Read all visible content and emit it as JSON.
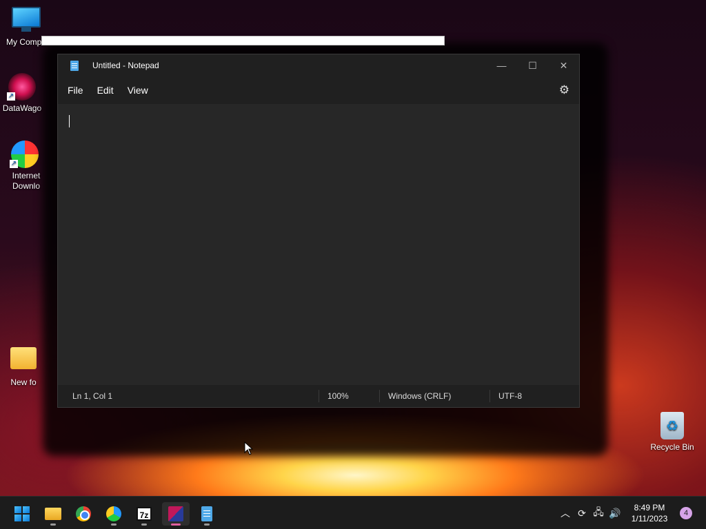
{
  "desktop": {
    "icons": [
      {
        "label": "My Compu"
      },
      {
        "label": "DataWago"
      },
      {
        "label": "Internet Downlo"
      },
      {
        "label": "New fo"
      },
      {
        "label": "Recycle Bin"
      }
    ]
  },
  "notepad": {
    "title": "Untitled - Notepad",
    "menu": [
      "File",
      "Edit",
      "View"
    ],
    "text": "",
    "status": {
      "position": "Ln 1, Col 1",
      "zoom": "100%",
      "line_ending": "Windows (CRLF)",
      "encoding": "UTF-8"
    }
  },
  "taskbar": {
    "apps": [
      "start",
      "file-explorer",
      "chrome",
      "internet-download-manager",
      "7-zip",
      "winrar",
      "notepad"
    ],
    "clock_time": "8:49 PM",
    "clock_date": "1/11/2023",
    "notification_count": "4"
  },
  "colors": {
    "window_bg": "#202020",
    "editor_bg": "#272727",
    "taskbar_bg": "#1c1c1c",
    "accent": "#4fa9e8"
  }
}
